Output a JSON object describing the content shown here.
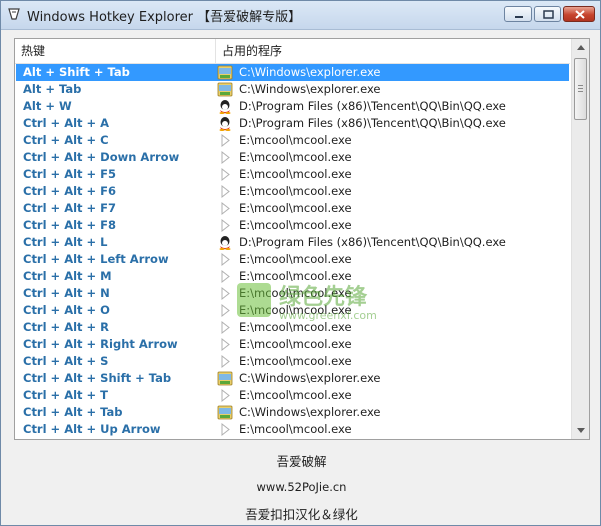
{
  "window": {
    "title": "Windows Hotkey Explorer  【吾爱破解专版】"
  },
  "columns": {
    "hotkey": "热键",
    "program": "占用的程序"
  },
  "rows": [
    {
      "key": "Alt + Shift + Tab",
      "icon": "explorer-icon",
      "path": "C:\\Windows\\explorer.exe",
      "selected": true
    },
    {
      "key": "Alt + Tab",
      "icon": "explorer-icon",
      "path": "C:\\Windows\\explorer.exe"
    },
    {
      "key": "Alt + W",
      "icon": "qq-icon",
      "path": "D:\\Program Files (x86)\\Tencent\\QQ\\Bin\\QQ.exe"
    },
    {
      "key": "Ctrl + Alt + A",
      "icon": "qq-icon",
      "path": "D:\\Program Files (x86)\\Tencent\\QQ\\Bin\\QQ.exe"
    },
    {
      "key": "Ctrl + Alt + C",
      "icon": "play-icon",
      "path": "E:\\mcool\\mcool.exe"
    },
    {
      "key": "Ctrl + Alt + Down Arrow",
      "icon": "play-icon",
      "path": "E:\\mcool\\mcool.exe"
    },
    {
      "key": "Ctrl + Alt + F5",
      "icon": "play-icon",
      "path": "E:\\mcool\\mcool.exe"
    },
    {
      "key": "Ctrl + Alt + F6",
      "icon": "play-icon",
      "path": "E:\\mcool\\mcool.exe"
    },
    {
      "key": "Ctrl + Alt + F7",
      "icon": "play-icon",
      "path": "E:\\mcool\\mcool.exe"
    },
    {
      "key": "Ctrl + Alt + F8",
      "icon": "play-icon",
      "path": "E:\\mcool\\mcool.exe"
    },
    {
      "key": "Ctrl + Alt + L",
      "icon": "qq-icon",
      "path": "D:\\Program Files (x86)\\Tencent\\QQ\\Bin\\QQ.exe"
    },
    {
      "key": "Ctrl + Alt + Left Arrow",
      "icon": "play-icon",
      "path": "E:\\mcool\\mcool.exe"
    },
    {
      "key": "Ctrl + Alt + M",
      "icon": "play-icon",
      "path": "E:\\mcool\\mcool.exe"
    },
    {
      "key": "Ctrl + Alt + N",
      "icon": "play-icon",
      "path": "E:\\mcool\\mcool.exe"
    },
    {
      "key": "Ctrl + Alt + O",
      "icon": "play-icon",
      "path": "E:\\mcool\\mcool.exe"
    },
    {
      "key": "Ctrl + Alt + R",
      "icon": "play-icon",
      "path": "E:\\mcool\\mcool.exe"
    },
    {
      "key": "Ctrl + Alt + Right Arrow",
      "icon": "play-icon",
      "path": "E:\\mcool\\mcool.exe"
    },
    {
      "key": "Ctrl + Alt + S",
      "icon": "play-icon",
      "path": "E:\\mcool\\mcool.exe"
    },
    {
      "key": "Ctrl + Alt + Shift + Tab",
      "icon": "explorer-icon",
      "path": "C:\\Windows\\explorer.exe"
    },
    {
      "key": "Ctrl + Alt + T",
      "icon": "play-icon",
      "path": "E:\\mcool\\mcool.exe"
    },
    {
      "key": "Ctrl + Alt + Tab",
      "icon": "explorer-icon",
      "path": "C:\\Windows\\explorer.exe"
    },
    {
      "key": "Ctrl + Alt + Up Arrow",
      "icon": "play-icon",
      "path": "E:\\mcool\\mcool.exe"
    }
  ],
  "watermark": {
    "title": "绿色先锋",
    "url": "www.greenxf.com"
  },
  "footer": {
    "line1": "吾爱破解",
    "line2": "www.52PoJie.cn",
    "line3": "吾爱扣扣汉化＆绿化"
  },
  "colors": {
    "selection": "#3399ff",
    "hotkey_text": "#2a6fa8",
    "close_button": "#c7442e"
  }
}
